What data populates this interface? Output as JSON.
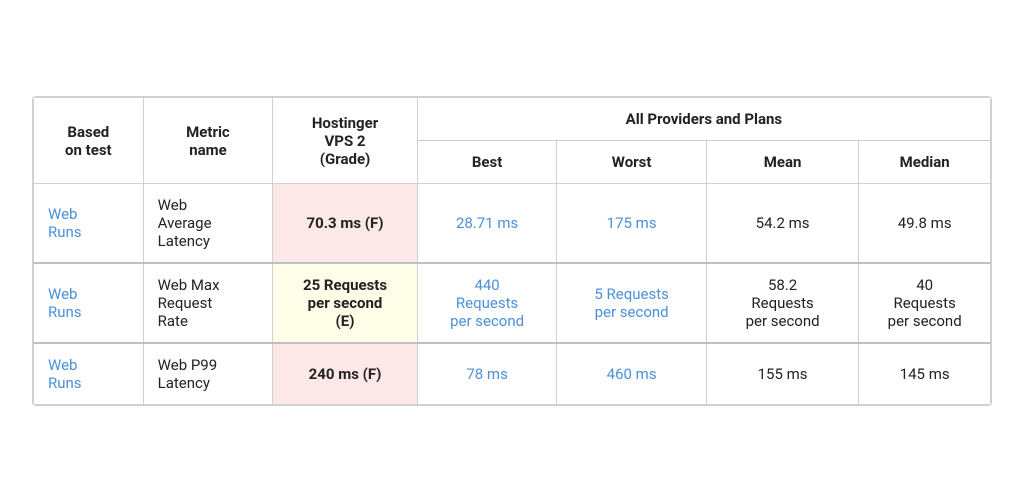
{
  "table": {
    "headers": {
      "col1": "Based\non test",
      "col2": "Metric\nname",
      "col3_line1": "Hostinger",
      "col3_line2": "VPS 2",
      "col3_line3": "(Grade)",
      "all_providers": "All Providers and Plans",
      "best": "Best",
      "worst": "Worst",
      "mean": "Mean",
      "median": "Median"
    },
    "rows": [
      {
        "id": 1,
        "based_on": "Web\nRuns",
        "metric": "Web\nAverage\nLatency",
        "hostinger_val": "70.3 ms (F)",
        "hostinger_grade": "F",
        "best": "28.71 ms",
        "worst": "175 ms",
        "mean": "54.2 ms",
        "median": "49.8 ms",
        "best_is_link": true,
        "worst_is_link": true
      },
      {
        "id": 2,
        "based_on": "Web\nRuns",
        "metric": "Web Max\nRequest\nRate",
        "hostinger_val": "25 Requests\nper second\n(E)",
        "hostinger_grade": "E",
        "best": "440\nRequests\nper second",
        "worst": "5 Requests\nper second",
        "mean": "58.2\nRequests\nper second",
        "median": "40\nRequests\nper second",
        "best_is_link": true,
        "worst_is_link": true
      },
      {
        "id": 3,
        "based_on": "Web\nRuns",
        "metric": "Web P99\nLatency",
        "hostinger_val": "240 ms (F)",
        "hostinger_grade": "F",
        "best": "78 ms",
        "worst": "460 ms",
        "mean": "155 ms",
        "median": "145 ms",
        "best_is_link": true,
        "worst_is_link": true
      }
    ]
  }
}
